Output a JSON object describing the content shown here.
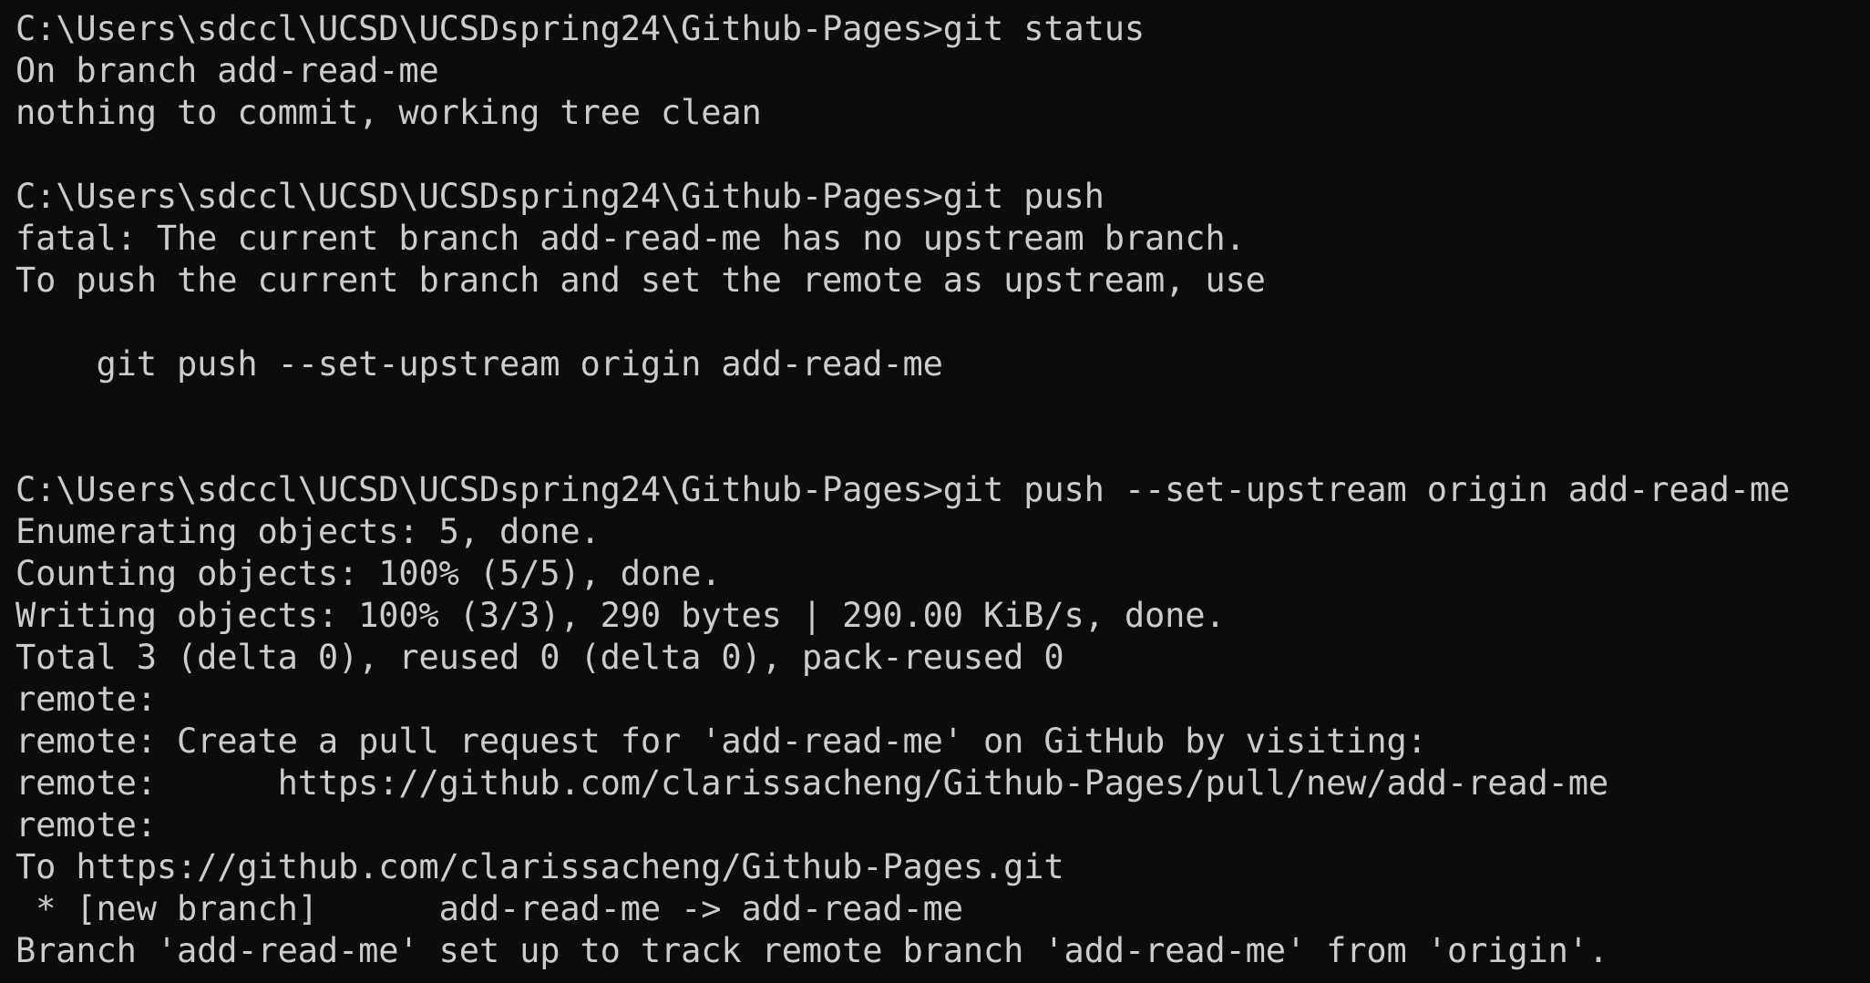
{
  "terminal": {
    "lines": [
      "C:\\Users\\sdccl\\UCSD\\UCSDspring24\\Github-Pages>git status",
      "On branch add-read-me",
      "nothing to commit, working tree clean",
      "",
      "C:\\Users\\sdccl\\UCSD\\UCSDspring24\\Github-Pages>git push",
      "fatal: The current branch add-read-me has no upstream branch.",
      "To push the current branch and set the remote as upstream, use",
      "",
      "    git push --set-upstream origin add-read-me",
      "",
      "",
      "C:\\Users\\sdccl\\UCSD\\UCSDspring24\\Github-Pages>git push --set-upstream origin add-read-me",
      "Enumerating objects: 5, done.",
      "Counting objects: 100% (5/5), done.",
      "Writing objects: 100% (3/3), 290 bytes | 290.00 KiB/s, done.",
      "Total 3 (delta 0), reused 0 (delta 0), pack-reused 0",
      "remote:",
      "remote: Create a pull request for 'add-read-me' on GitHub by visiting:",
      "remote:      https://github.com/clarissacheng/Github-Pages/pull/new/add-read-me",
      "remote:",
      "To https://github.com/clarissacheng/Github-Pages.git",
      " * [new branch]      add-read-me -> add-read-me",
      "Branch 'add-read-me' set up to track remote branch 'add-read-me' from 'origin'."
    ]
  }
}
